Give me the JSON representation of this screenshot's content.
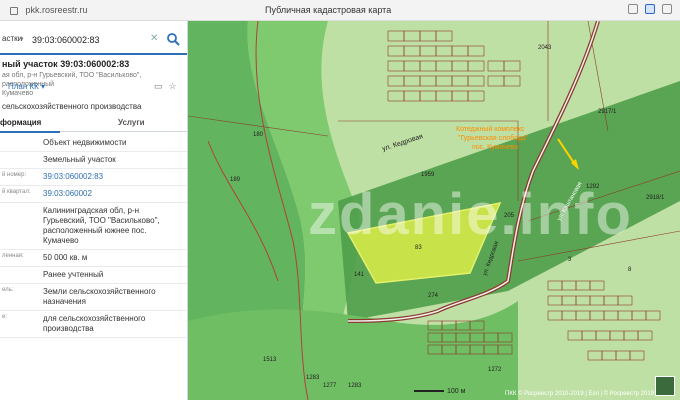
{
  "browser": {
    "url": "pkk.rosreestr.ru",
    "title": "Публичная кадастровая карта"
  },
  "search": {
    "select_label": "астки",
    "query": "39:03:060002:83"
  },
  "card": {
    "title": "ный участок 39:03:060002:83",
    "address": "ая обл, р-н Гурьевский, ТОО \"Васильково\", расположенный\nКумачево",
    "purpose": "сельскохозяйственного производства",
    "plan_link": "План КК"
  },
  "tabs": [
    "формация",
    "Услуги"
  ],
  "rows": [
    {
      "label": "",
      "value": "Объект недвижимости",
      "link": false
    },
    {
      "label": "",
      "value": "Земельный участок",
      "link": false
    },
    {
      "label": "й номер:",
      "value": "39:03:060002:83",
      "link": true
    },
    {
      "label": "й квартал:",
      "value": "39:03:060002",
      "link": true
    },
    {
      "label": "",
      "value": "Калининградская обл, р-н Гурьевский, ТОО \"Васильково\", расположенный южнее пос. Кумачево",
      "link": false
    },
    {
      "label": "ленная:",
      "value": "50 000 кв. м",
      "link": false
    },
    {
      "label": "",
      "value": "Ранее учтенный",
      "link": false
    },
    {
      "label": "ель:",
      "value": "Земли сельскохозяйственного назначения",
      "link": false
    },
    {
      "label": "е:",
      "value": "для сельскохозяйственного производства",
      "link": false
    }
  ],
  "map": {
    "street_label": "ул. Кедровая",
    "cottage_label": "Котеджный комплекс\n\"Гурьевская слобода\"\nпос. Кумачево",
    "road_label": "ул. Кедровая",
    "angled_label": "ул. Каштановая",
    "scale": "100 м",
    "copyright": "ПКК © Росреестр 2010-2019 | Esri | © Росреестр 2019",
    "watermark": "zdanie.info",
    "parcel_numbers": [
      "1959",
      "180",
      "189",
      "83",
      "274",
      "141",
      "205",
      "2043",
      "2917/1",
      "2918/1",
      "1292",
      "1513",
      "1272",
      "1283",
      "1277",
      "1283",
      "3",
      "8"
    ]
  },
  "colors": {
    "accent": "#2f6fb7",
    "map_bg": "#bfe0a4",
    "forest": "#62b55e",
    "parcel": "#c8e24a",
    "road": "#8b3a2c"
  },
  "icons": [
    "lock-icon",
    "search-icon",
    "clear-icon",
    "print-icon",
    "star-icon"
  ]
}
